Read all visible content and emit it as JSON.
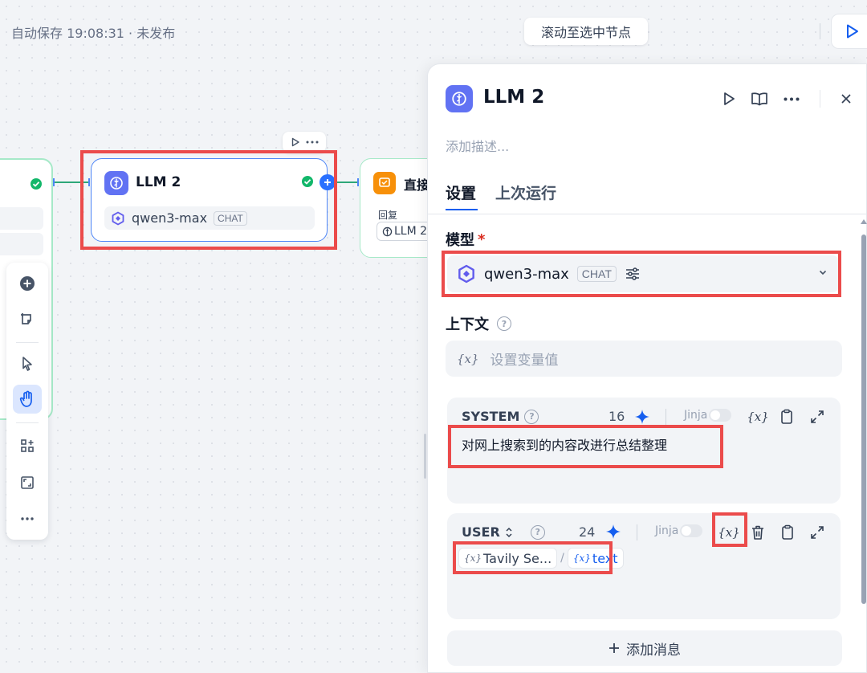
{
  "topbar": {
    "autosave_text": "自动保存 19:08:31 · 未发布",
    "scroll_to_selected": "滚动至选中节点"
  },
  "canvas": {
    "llm_node": {
      "title": "LLM 2",
      "model": "qwen3-max",
      "mode_badge": "CHAT"
    },
    "answer_node": {
      "title": "直接",
      "reply_label": "回复",
      "reply_ref": "LLM 2"
    }
  },
  "panel": {
    "title": "LLM 2",
    "description_placeholder": "添加描述...",
    "tabs": [
      {
        "label": "设置"
      },
      {
        "label": "上次运行"
      }
    ],
    "model_section": {
      "label": "模型",
      "required_mark": "*",
      "model": "qwen3-max",
      "mode_badge": "CHAT"
    },
    "context_section": {
      "label": "上下文",
      "var_glyph": "{x}",
      "placeholder": "设置变量值"
    },
    "messages": [
      {
        "role": "SYSTEM",
        "count": "16",
        "jinja_label": "Jinja",
        "text": "对网上搜索到的内容改进行总结整理"
      },
      {
        "role": "USER",
        "count": "24",
        "jinja_label": "Jinja",
        "tag_node": "Tavily Se...",
        "tag_separator": "/",
        "tag_var": "text"
      }
    ],
    "add_message": "添加消息"
  },
  "colors": {
    "accent": "#155eef",
    "llm_icon": "#6172f3",
    "answer_icon": "#f79009",
    "success": "#12b76a",
    "highlight_box": "#eb4b4b"
  }
}
